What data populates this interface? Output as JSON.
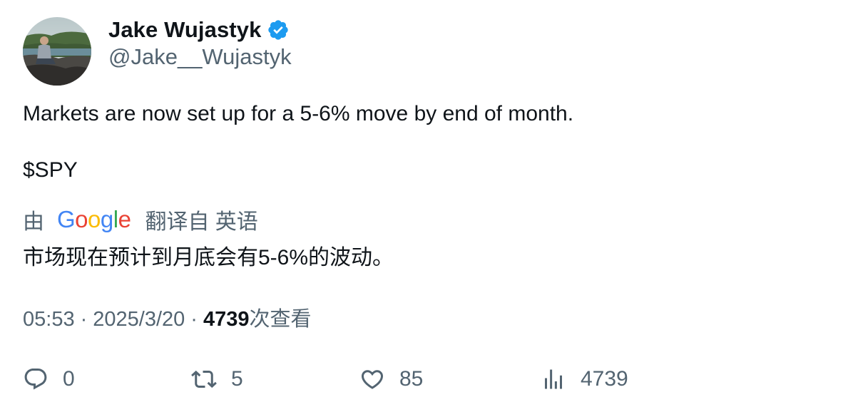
{
  "author": {
    "display_name": "Jake Wujastyk",
    "handle": "@Jake__Wujastyk",
    "verified": true,
    "verified_color": "#1d9bf0",
    "avatar_icon": "user-avatar-photo"
  },
  "tweet": {
    "line1": "Markets are now set up for a 5-6% move by end of month.",
    "line2": "$SPY"
  },
  "translation": {
    "by_label": "由",
    "provider": "Google",
    "from_label": "翻译自 英语",
    "text": "市场现在预计到月底会有5-6%的波动。"
  },
  "meta": {
    "time": "05:53",
    "separator": "·",
    "date": "2025/3/20",
    "views_count": "4739",
    "views_label": "次查看"
  },
  "actions": {
    "reply_count": "0",
    "retweet_count": "5",
    "like_count": "85",
    "views_count": "4739"
  },
  "colors": {
    "text": "#0f1419",
    "secondary": "#536471",
    "verified": "#1d9bf0"
  }
}
